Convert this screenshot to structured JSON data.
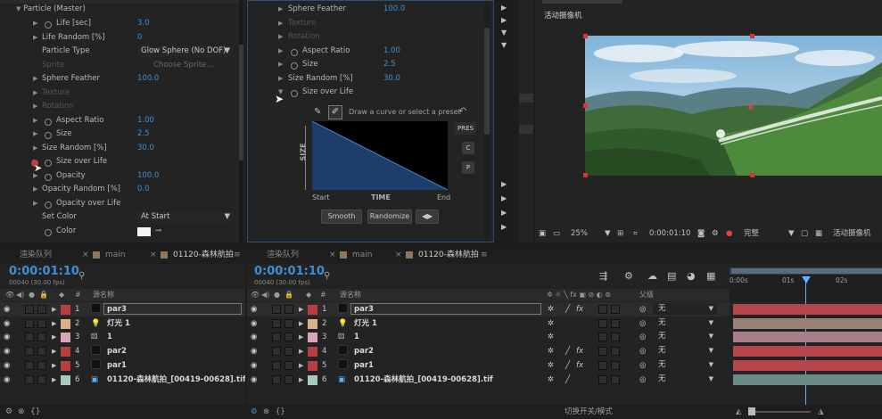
{
  "left_effects": {
    "header": "Particle (Master)",
    "rows": [
      {
        "label": "Life [sec]",
        "value": "3.0",
        "tri": true,
        "sw": true
      },
      {
        "label": "Life Random [%]",
        "value": "0",
        "tri": true,
        "sw": false
      },
      {
        "label": "Particle Type",
        "value": "Glow Sphere (No DOF)",
        "tri": false,
        "sw": false,
        "dropdown": true
      },
      {
        "label": "Sprite",
        "value": "Choose Sprite...",
        "tri": false,
        "sw": false,
        "dim": true
      },
      {
        "label": "Sphere Feather",
        "value": "100.0",
        "tri": true,
        "sw": false
      },
      {
        "label": "Texture",
        "value": "",
        "tri": true,
        "sw": false,
        "dim": true
      },
      {
        "label": "Rotation",
        "value": "",
        "tri": true,
        "sw": false,
        "dim": true
      },
      {
        "label": "Aspect Ratio",
        "value": "1.00",
        "tri": true,
        "sw": true
      },
      {
        "label": "Size",
        "value": "2.5",
        "tri": true,
        "sw": true
      },
      {
        "label": "Size Random [%]",
        "value": "30.0",
        "tri": true,
        "sw": false
      },
      {
        "label": "Size over Life",
        "value": "",
        "tri": true,
        "sw": true
      },
      {
        "label": "Opacity",
        "value": "100.0",
        "tri": true,
        "sw": true
      },
      {
        "label": "Opacity Random [%]",
        "value": "0.0",
        "tri": true,
        "sw": false
      },
      {
        "label": "Opacity over Life",
        "value": "",
        "tri": true,
        "sw": true
      },
      {
        "label": "Set Color",
        "value": "At Start",
        "tri": false,
        "sw": false,
        "dropdown": true
      },
      {
        "label": "Color",
        "value": "",
        "tri": false,
        "sw": true,
        "color": true
      }
    ]
  },
  "mid_effects": {
    "rows": [
      {
        "label": "Sphere Feather",
        "value": "100.0",
        "sw": false
      },
      {
        "label": "Texture",
        "value": "",
        "sw": false,
        "dim": true
      },
      {
        "label": "Rotation",
        "value": "",
        "sw": false,
        "dim": true
      },
      {
        "label": "Aspect Ratio",
        "value": "1.00",
        "sw": true
      },
      {
        "label": "Size",
        "value": "2.5",
        "sw": true
      },
      {
        "label": "Size Random [%]",
        "value": "30.0",
        "sw": false
      },
      {
        "label": "Size over Life",
        "value": "",
        "sw": true,
        "open": true
      }
    ],
    "curve": {
      "hint": "Draw a curve or select a preset",
      "y_label": "SIZE",
      "x_start": "Start",
      "x_mid": "TIME",
      "x_end": "End",
      "smooth": "Smooth",
      "randomize": "Randomize",
      "preset": "PRES",
      "c": "C",
      "p": "P"
    }
  },
  "viewer": {
    "title": "活动摄像机",
    "zoom": "25%",
    "timecode": "0:00:01:10",
    "quality": "完整",
    "camera": "活动摄像机"
  },
  "left_tl": {
    "tabs": [
      {
        "label": "渲染队列"
      },
      {
        "label": "main"
      },
      {
        "label": "01120-森林航拍"
      }
    ],
    "timecode": "0:00:01:10",
    "fps": "00040 (30.00 fps)",
    "col_name": "源名称"
  },
  "right_tl": {
    "tabs": [
      {
        "label": "渲染队列"
      },
      {
        "label": "main"
      },
      {
        "label": "01120-森林航拍"
      }
    ],
    "timecode": "0:00:01:10",
    "fps": "00040 (30.00 fps)",
    "col_name": "源名称",
    "col_parent": "父级",
    "ruler": [
      "0:00s",
      "01s",
      "02s"
    ],
    "footer": "切换开关/模式"
  },
  "layers": [
    {
      "num": "1",
      "name": "par3",
      "color": "#b83f3f",
      "icon": "box",
      "selected": true,
      "parent": "无"
    },
    {
      "num": "2",
      "name": "灯光 1",
      "color": "#d9b28c",
      "icon": "bulb",
      "parent": "无"
    },
    {
      "num": "3",
      "name": "1",
      "color": "#d6a8b6",
      "icon": "cam",
      "parent": "无"
    },
    {
      "num": "4",
      "name": "par2",
      "color": "#b83f3f",
      "icon": "box",
      "parent": "无"
    },
    {
      "num": "5",
      "name": "par1",
      "color": "#b83f3f",
      "icon": "box",
      "parent": "无"
    },
    {
      "num": "6",
      "name": "01120-森林航拍_[00419-00628].tif",
      "color": "#a8c8c0",
      "icon": "film",
      "parent": "无"
    }
  ],
  "bar_colors": [
    "#b5464c",
    "#9a8278",
    "#a87f8a",
    "#b5464c",
    "#b5464c",
    "#6e8a86"
  ]
}
